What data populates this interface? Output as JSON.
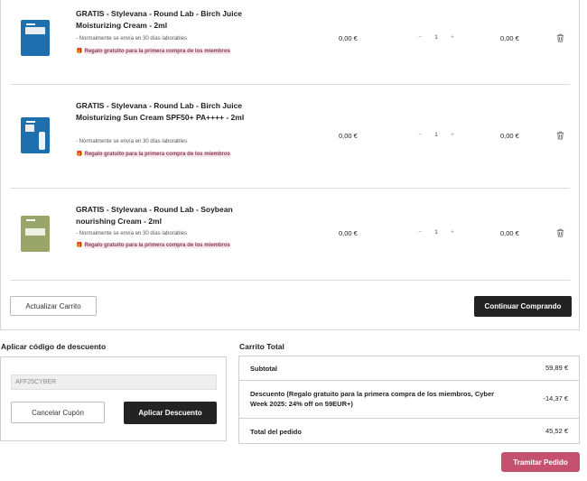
{
  "cart": {
    "items": [
      {
        "name": "GRATIS - Stylevana - Round Lab - Birch Juice Moisturizing Cream - 2ml",
        "shipping": "- Normalmente se envía en 30 días laborables",
        "gift": "Regalo gratuito para la primera compra de los miembros",
        "price": "0,00 €",
        "qty": "1",
        "total": "0,00 €",
        "thumb_color": "#1d6fae"
      },
      {
        "name": "GRATIS - Stylevana - Round Lab - Birch Juice Moisturizing Sun Cream SPF50+ PA++++ - 2ml",
        "shipping": "- Normalmente se envía en 30 días laborables",
        "gift": "Regalo gratuito para la primera compra de los miembros",
        "price": "0,00 €",
        "qty": "1",
        "total": "0,00 €",
        "thumb_color": "#1d6fae"
      },
      {
        "name": "GRATIS - Stylevana - Round Lab - Soybean nourishing Cream - 2ml",
        "shipping": "- Normalmente se envía en 30 días laborables",
        "gift": "Regalo gratuito para la primera compra de los miembros",
        "price": "0,00 €",
        "qty": "1",
        "total": "0,00 €",
        "thumb_color": "#9aa56a"
      }
    ],
    "qty_minus": "−",
    "qty_plus": "+",
    "update_label": "Actualizar Carrito",
    "continue_label": "Continuar Comprando"
  },
  "coupon": {
    "title": "Aplicar código de descuento",
    "value": "AFF25CYBER",
    "cancel_label": "Cancelar Cupón",
    "apply_label": "Aplicar Descuento"
  },
  "totals": {
    "title": "Carrito Total",
    "subtotal_label": "Subtotal",
    "subtotal_value": "59,89 €",
    "discount_label": "Descuento (Regalo gratuito para la primera compra de los miembros, Cyber Week 2025: 24% off on 59EUR+)",
    "discount_value": "-14,37 €",
    "order_total_label": "Total del pedido",
    "order_total_value": "45,52 €",
    "checkout_label": "Tramitar Pedido"
  },
  "colors": {
    "accent": "#c4526f",
    "dark_button": "#232323",
    "gift_text": "#8a3c54"
  },
  "icons": {
    "remove": "trash-icon",
    "gift": "gift-icon"
  }
}
